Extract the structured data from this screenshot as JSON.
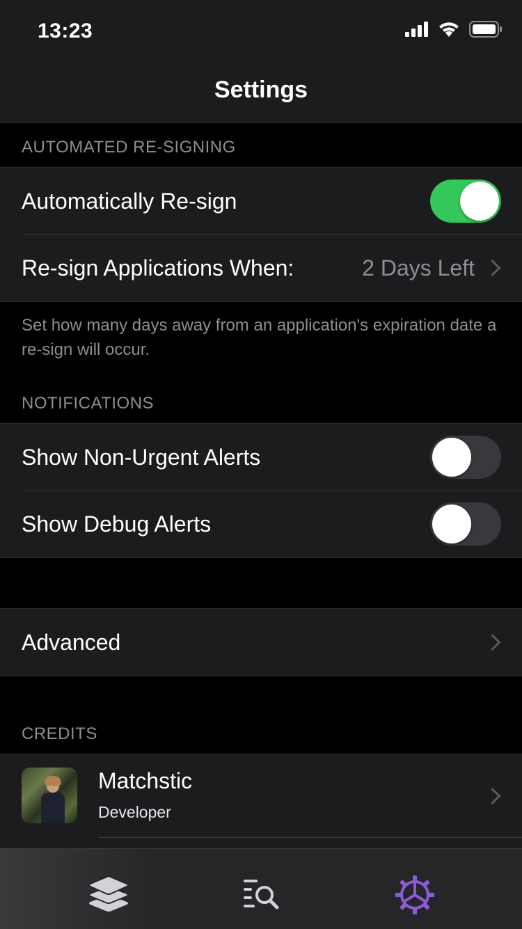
{
  "status_bar": {
    "time": "13:23"
  },
  "nav": {
    "title": "Settings"
  },
  "sections": {
    "resign": {
      "header": "AUTOMATED RE-SIGNING",
      "auto_resign_label": "Automatically Re-sign",
      "auto_resign_on": true,
      "resign_when_label": "Re-sign Applications When:",
      "resign_when_value": "2 Days Left",
      "footer": "Set how many days away from an application's expiration date a re-sign will occur."
    },
    "notifications": {
      "header": "NOTIFICATIONS",
      "non_urgent_label": "Show Non-Urgent Alerts",
      "non_urgent_on": false,
      "debug_label": "Show Debug Alerts",
      "debug_on": false
    },
    "advanced": {
      "label": "Advanced"
    },
    "credits": {
      "header": "CREDITS",
      "items": [
        {
          "name": "Matchstic",
          "role": "Developer"
        }
      ]
    }
  },
  "tabs": [
    {
      "icon": "stack-icon",
      "active": false
    },
    {
      "icon": "search-list-icon",
      "active": false
    },
    {
      "icon": "gear-icon",
      "active": true
    }
  ],
  "colors": {
    "accent": "#8e5ad6",
    "toggle_on": "#34c759",
    "background": "#000000",
    "cell": "#1c1c1e",
    "secondary_text": "#8e8e93"
  }
}
